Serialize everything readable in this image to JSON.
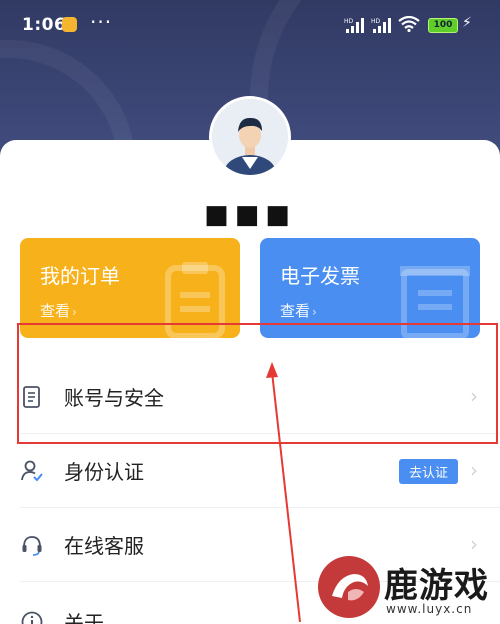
{
  "status_bar": {
    "time": "1:06",
    "more": "···",
    "signal1_label": "HD",
    "signal2_label": "HD",
    "battery": "100",
    "icons": [
      "app-notification-icon",
      "signal-icon",
      "signal-icon",
      "wifi-icon",
      "battery-icon",
      "charging-icon"
    ]
  },
  "profile": {
    "username": "■■■"
  },
  "tiles": [
    {
      "title": "我的订单",
      "sub": "查看",
      "color": "#f7b11b",
      "icon": "order-icon"
    },
    {
      "title": "电子发票",
      "sub": "查看",
      "color": "#4a8ef2",
      "icon": "invoice-icon"
    }
  ],
  "menu": [
    {
      "label": "账号与安全",
      "icon": "document-icon"
    },
    {
      "label": "身份认证",
      "icon": "user-check-icon",
      "badge": "去认证"
    },
    {
      "label": "在线客服",
      "icon": "headset-icon"
    },
    {
      "label": "关于",
      "icon": "info-icon"
    }
  ],
  "annotation": {
    "color": "#e53935"
  },
  "watermark": {
    "brand": "鹿游戏",
    "url": "www.luyx.cn"
  }
}
